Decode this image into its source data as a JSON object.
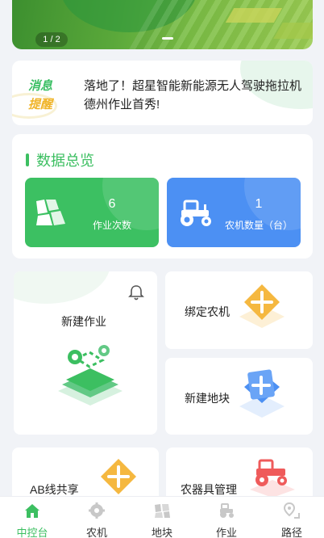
{
  "banner": {
    "counter": "1 / 2"
  },
  "notice": {
    "tag_line1": "消息",
    "tag_line2": "提醒",
    "message": "落地了！超星智能新能源无人驾驶拖拉机德州作业首秀!"
  },
  "overview": {
    "title": "数据总览",
    "stats": [
      {
        "value": "6",
        "label": "作业次数",
        "color": "#3cc062",
        "icon": "field-map-icon"
      },
      {
        "value": "1",
        "label": "农机数量（台）",
        "color": "#4c90f3",
        "icon": "tractor-icon"
      }
    ]
  },
  "actions": {
    "new_job": "新建作业",
    "bind_machine": "绑定农机",
    "new_plot": "新建地块",
    "ab_line": "AB线共享",
    "implement_mgmt": "农器具管理"
  },
  "tabs": [
    {
      "label": "中控台",
      "icon": "home-icon",
      "active": true
    },
    {
      "label": "农机",
      "icon": "machine-gear-icon",
      "active": false
    },
    {
      "label": "地块",
      "icon": "plot-icon",
      "active": false
    },
    {
      "label": "作业",
      "icon": "tractor-icon",
      "active": false
    },
    {
      "label": "路径",
      "icon": "route-pin-icon",
      "active": false
    }
  ],
  "colors": {
    "accent_green": "#3cbf61",
    "accent_blue": "#4c90f3",
    "warning_yellow": "#f0b429"
  }
}
